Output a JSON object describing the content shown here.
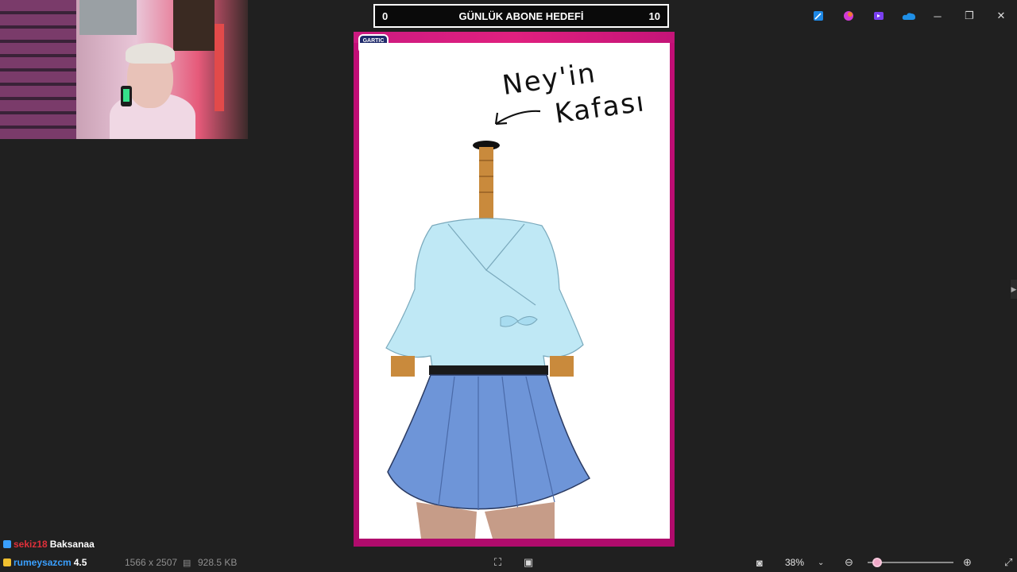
{
  "goal_bar": {
    "left_value": "0",
    "title": "GÜNLÜK ABONE HEDEFİ",
    "right_value": "10"
  },
  "window_controls": {
    "minimize": "─",
    "restore": "❐",
    "close": "✕"
  },
  "tray_icons": [
    "pen-icon",
    "paint-icon",
    "video-editor-icon",
    "onedrive-icon"
  ],
  "artwork": {
    "logo_text": "GARTIC PHONE",
    "note_line1": "Ney'in",
    "note_line2": "Kafası",
    "arrow": "↙"
  },
  "chat": [
    {
      "user": "sekiz18",
      "message": "Baksanaa",
      "user_color": "#e0303a"
    },
    {
      "user": "rumeysazcm",
      "message": "4.5",
      "user_color": "#3aa0ff"
    }
  ],
  "status_bar": {
    "dimensions": "1566 x 2507",
    "file_size": "928.5 KB",
    "zoom": "38%"
  },
  "colors": {
    "frame": "#c20e76",
    "blouse": "#bfe8f5",
    "skirt": "#6e95d8",
    "skin": "#c98a3c"
  }
}
